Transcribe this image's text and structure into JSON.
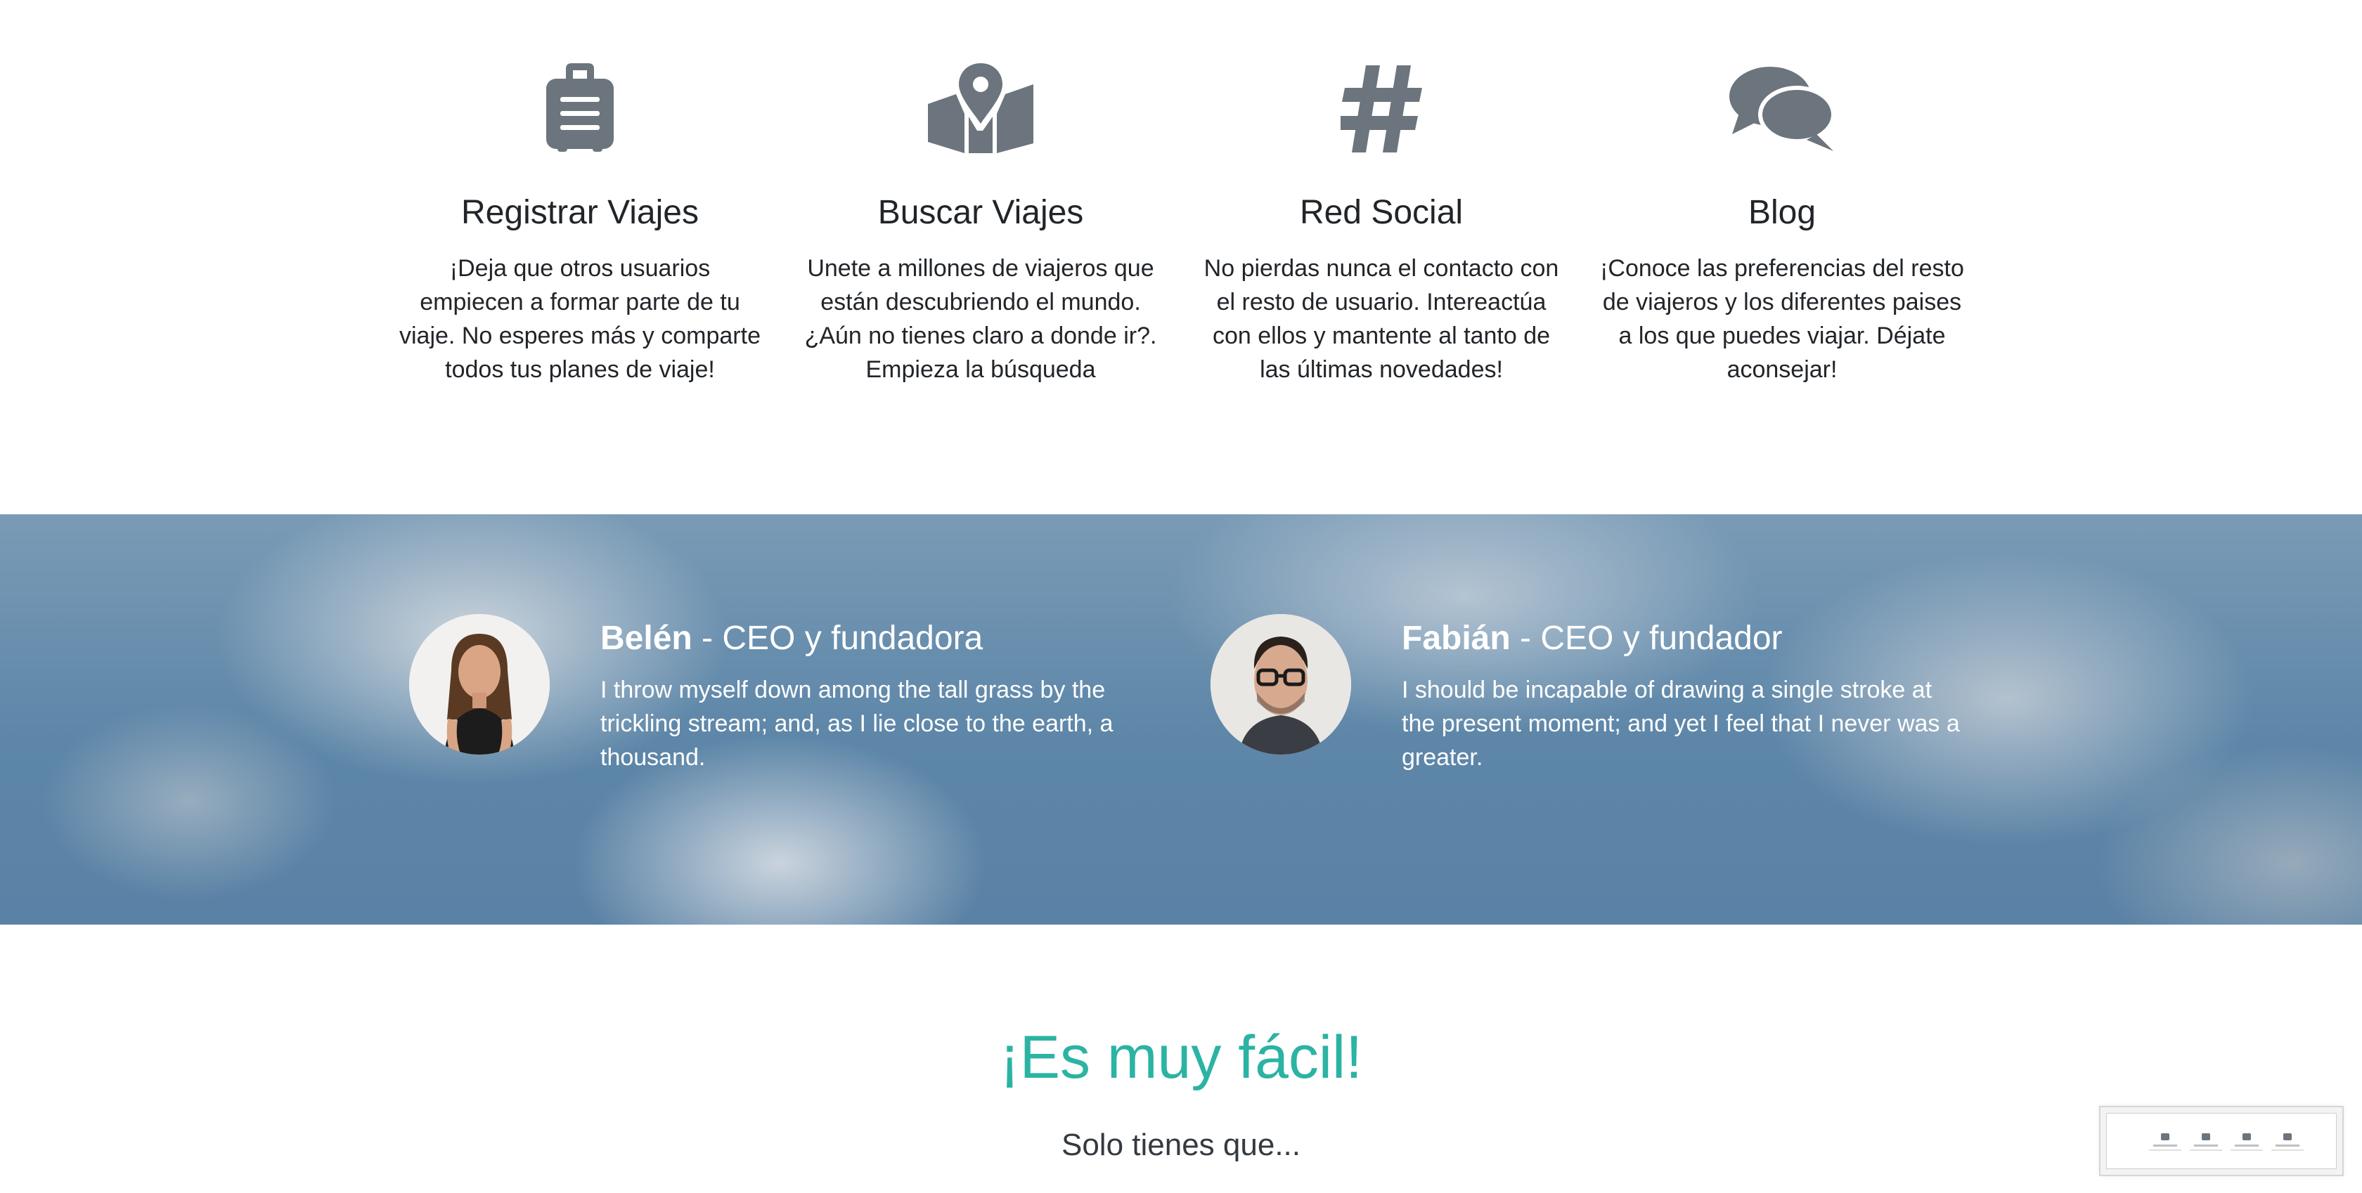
{
  "features": [
    {
      "icon": "suitcase-icon",
      "title": "Registrar Viajes",
      "text": "¡Deja que otros usuarios empiecen a formar parte de tu viaje. No esperes más y comparte todos tus planes de viaje!"
    },
    {
      "icon": "map-marked-icon",
      "title": "Buscar Viajes",
      "text": "Unete a millones de viajeros que están descubriendo el mundo. ¿Aún no tienes claro a donde ir?. Empieza la búsqueda"
    },
    {
      "icon": "hashtag-icon",
      "title": "Red Social",
      "text": "No pierdas nunca el contacto con el resto de usuario. Intereactúa con ellos y mantente al tanto de las últimas novedades!"
    },
    {
      "icon": "comments-icon",
      "title": "Blog",
      "text": "¡Conoce las preferencias del resto de viajeros y los diferentes paises a los que puedes viajar. Déjate aconsejar!"
    }
  ],
  "testimonials": [
    {
      "name": "Belén",
      "role": " - CEO y fundadora",
      "quote": "I throw myself down among the tall grass by the trickling stream; and, as I lie close to the earth, a thousand."
    },
    {
      "name": "Fabián",
      "role": " - CEO y fundador",
      "quote": "I should be incapable of drawing a single stroke at the present moment; and yet I feel that I never was a greater."
    }
  ],
  "cta": {
    "heading": "¡Es muy fácil!",
    "subheading": "Solo tienes que..."
  },
  "colors": {
    "icon": "#6c757d",
    "accent": "#2bb3a3",
    "banner": "#5d86a8"
  }
}
